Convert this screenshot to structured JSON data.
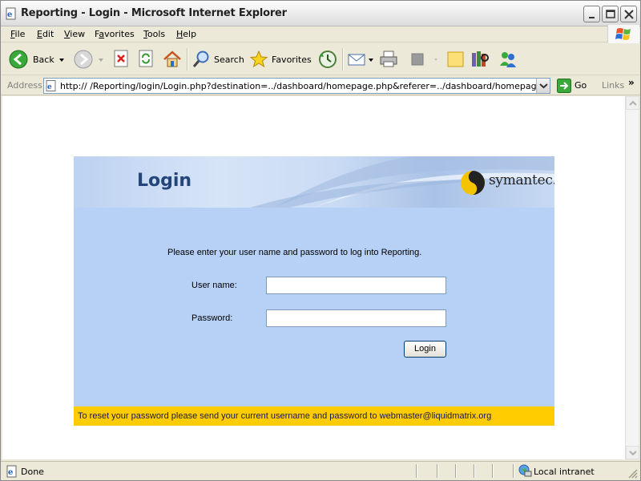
{
  "window": {
    "title": "Reporting - Login - Microsoft Internet Explorer"
  },
  "menu": {
    "items": [
      "File",
      "Edit",
      "View",
      "Favorites",
      "Tools",
      "Help"
    ],
    "accelerators": [
      "F",
      "E",
      "V",
      "a",
      "T",
      "H"
    ]
  },
  "toolbar": {
    "back_label": "Back",
    "search_label": "Search",
    "favorites_label": "Favorites"
  },
  "address": {
    "label": "Address",
    "url": "http://            /Reporting/login/Login.php?destination=../dashboard/homepage.php&referer=../dashboard/homepage.php",
    "go_label": "Go",
    "links_label": "Links",
    "links_chevron": "»"
  },
  "page": {
    "title": "Login",
    "brand": "symantec.",
    "prompt": "Please enter your user name and password to log into Reporting.",
    "username_label": "User name:",
    "password_label": "Password:",
    "username_value": "",
    "password_value": "",
    "login_button": "Login",
    "footer": "To reset your password please send your current username and password to webmaster@liquidmatrix.org",
    "colors": {
      "panel_bg": "#b7d1f6",
      "title": "#23457a",
      "footer_bg": "#ffcc00"
    }
  },
  "status": {
    "text": "Done",
    "zone": "Local intranet"
  },
  "icons": [
    "ie-page-icon",
    "minimize-icon",
    "maximize-icon",
    "close-icon",
    "windows-logo-icon",
    "back-icon",
    "forward-icon",
    "stop-icon",
    "refresh-icon",
    "home-icon",
    "search-icon",
    "favorites-star-icon",
    "history-icon",
    "mail-icon",
    "print-icon",
    "edit-icon",
    "discuss-icon",
    "research-icon",
    "messenger-icon",
    "go-arrow-icon",
    "symantec-logo-icon",
    "local-intranet-icon"
  ]
}
